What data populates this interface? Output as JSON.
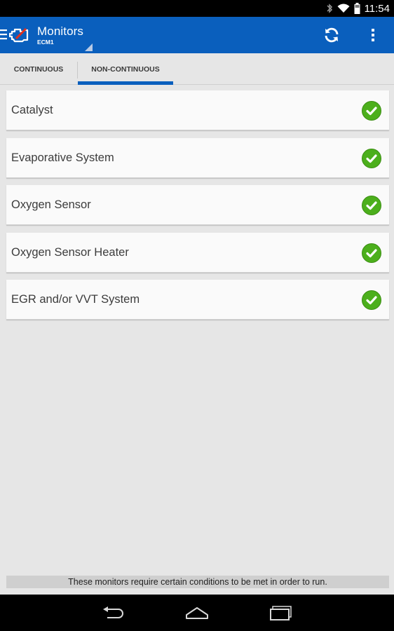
{
  "status_bar": {
    "time": "11:54",
    "icons": [
      "bluetooth-icon",
      "wifi-icon",
      "battery-icon"
    ]
  },
  "action_bar": {
    "title": "Monitors",
    "subtitle": "ECM1",
    "icons": [
      "menu-icon",
      "engine-icon",
      "refresh-icon",
      "overflow-menu-icon"
    ],
    "color": "#0a5fbd"
  },
  "tabs": [
    {
      "label": "CONTINUOUS",
      "selected": false
    },
    {
      "label": "NON-CONTINUOUS",
      "selected": true
    }
  ],
  "monitors": [
    {
      "label": "Catalyst",
      "status": "complete"
    },
    {
      "label": "Evaporative System",
      "status": "complete"
    },
    {
      "label": "Oxygen Sensor",
      "status": "complete"
    },
    {
      "label": "Oxygen Sensor Heater",
      "status": "complete"
    },
    {
      "label": "EGR and/or VVT System",
      "status": "complete"
    }
  ],
  "footer": {
    "note": "These monitors require certain conditions to be met in order to run."
  },
  "colors": {
    "accent": "#0a5fbd",
    "check_green": "#4caf1c",
    "background": "#e6e6e6"
  },
  "nav_bar": {
    "icons": [
      "back-icon",
      "home-icon",
      "recents-icon"
    ]
  }
}
